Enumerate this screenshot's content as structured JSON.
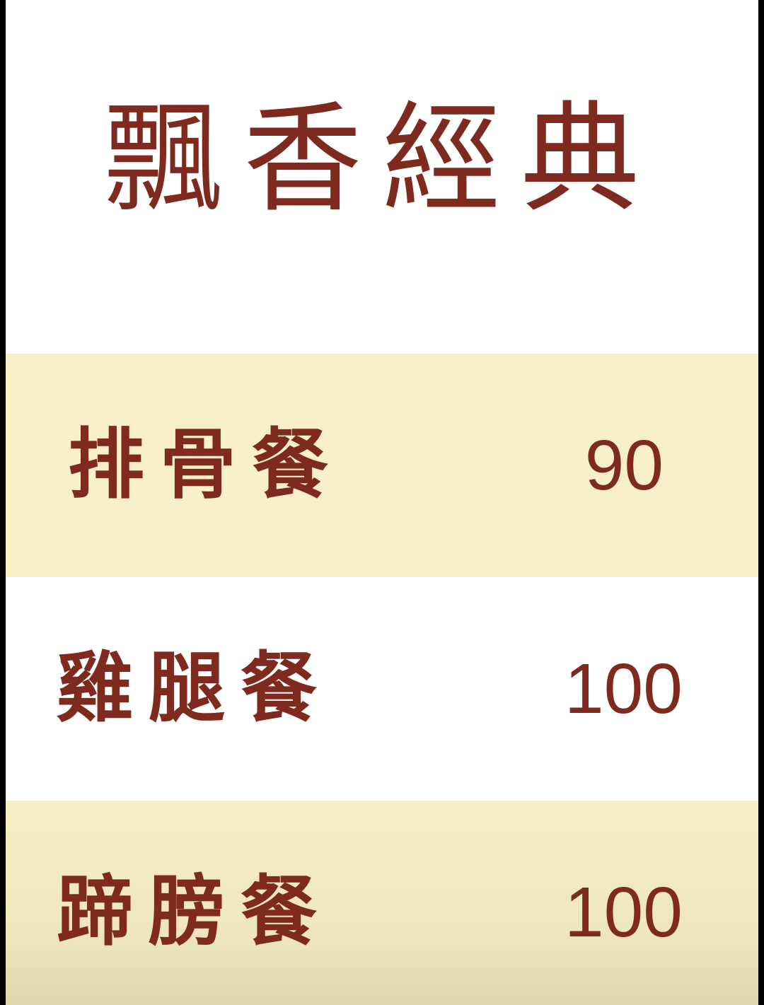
{
  "menu": {
    "title": "飄香經典",
    "items": [
      {
        "name": "排骨餐",
        "price": "90"
      },
      {
        "name": "雞腿餐",
        "price": "100"
      },
      {
        "name": "蹄膀餐",
        "price": "100"
      }
    ]
  },
  "colors": {
    "text": "#7e2a1f",
    "stripe": "#f7f0c8",
    "background": "#ffffff",
    "border": "#000000"
  }
}
